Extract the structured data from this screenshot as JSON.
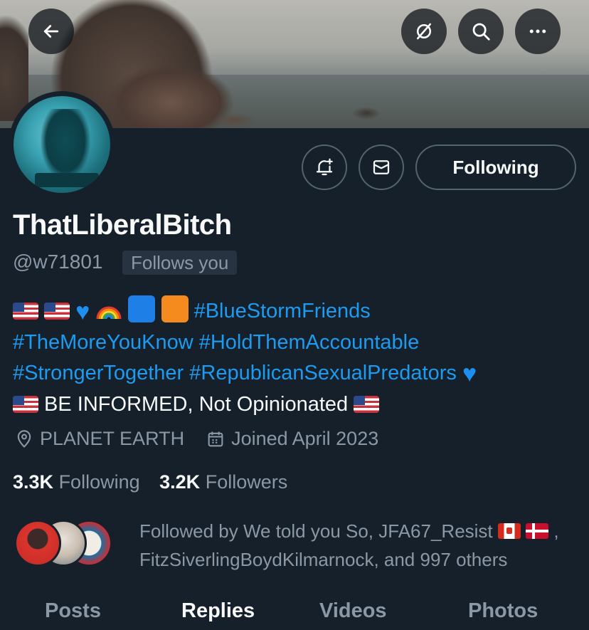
{
  "header": {
    "back_icon": "arrow-left-icon",
    "grok_icon": "slash-circle-icon",
    "search_icon": "search-icon",
    "more_icon": "more-horizontal-icon"
  },
  "profile": {
    "name": "ThatLiberalBitch",
    "handle": "@w71801",
    "follows_you": "Follows you",
    "following_label": "Following",
    "bio": {
      "line1_tag": "#BlueStormFriends",
      "line2": "#TheMoreYouKnow #HoldThemAccountable",
      "line3": "#StrongerTogether #RepublicanSexualPredators",
      "line4": " BE INFORMED, Not Opinionated "
    },
    "location": "PLANET EARTH",
    "joined": "Joined April 2023",
    "following_count": "3.3K",
    "following_text": "Following",
    "followers_count": "3.2K",
    "followers_text": "Followers",
    "followed_by_line1": "Followed by We told you So, JFA67_Resist",
    "followed_by_line2": "FitzSiverlingBoydKilmarnock, and 997 others"
  },
  "tabs": [
    "Posts",
    "Replies",
    "Videos",
    "Photos"
  ],
  "active_tab": "Replies",
  "colors": {
    "background": "#15202b",
    "accent": "#1d9bf0",
    "muted": "#8b98a5",
    "text": "#f7f9f9"
  }
}
